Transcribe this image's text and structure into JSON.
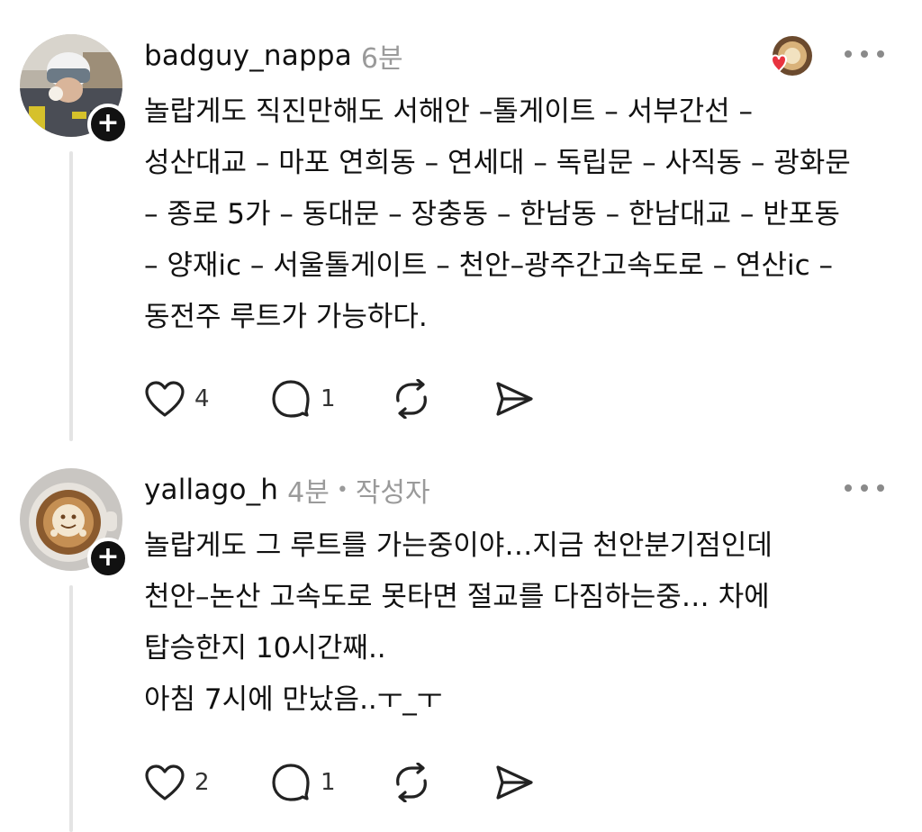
{
  "posts": [
    {
      "username": "badguy_nappa",
      "time": "6분",
      "author_tag": "",
      "text": "놀랍게도 직진만해도 서해안 –톨게이트 – 서부간선 –\n성산대교 – 마포 연희동 – 연세대 – 독립문 – 사직동 – 광화문\n– 종로 5가 – 동대문 – 장충동 – 한남동 – 한남대교 – 반포동\n– 양재ic – 서울톨게이트 – 천안–광주간고속도로 – 연산ic –\n동전주 루트가 가능하다.",
      "likes": "4",
      "replies": "1",
      "follow_symbol": "+"
    },
    {
      "username": "yallago_h",
      "time": "4분",
      "dot": "•",
      "author_tag": "작성자",
      "text": "놀랍게도 그 루트를 가는중이야…지금 천안분기점인데\n천안–논산 고속도로 못타면 절교를 다짐하는중… 차에\n탑승한지 10시간째..\n아침 7시에 만났음..ㅜ_ㅜ",
      "likes": "2",
      "replies": "1",
      "follow_symbol": "+"
    }
  ],
  "icons": {
    "like": "heart-icon",
    "reply": "comment-icon",
    "repost": "repost-icon",
    "share": "send-icon",
    "more": "more-icon"
  },
  "colors": {
    "text": "#111111",
    "muted": "#9a9a9a",
    "thread_line": "#e4e4e4",
    "liked_heart": "#e8333f"
  }
}
